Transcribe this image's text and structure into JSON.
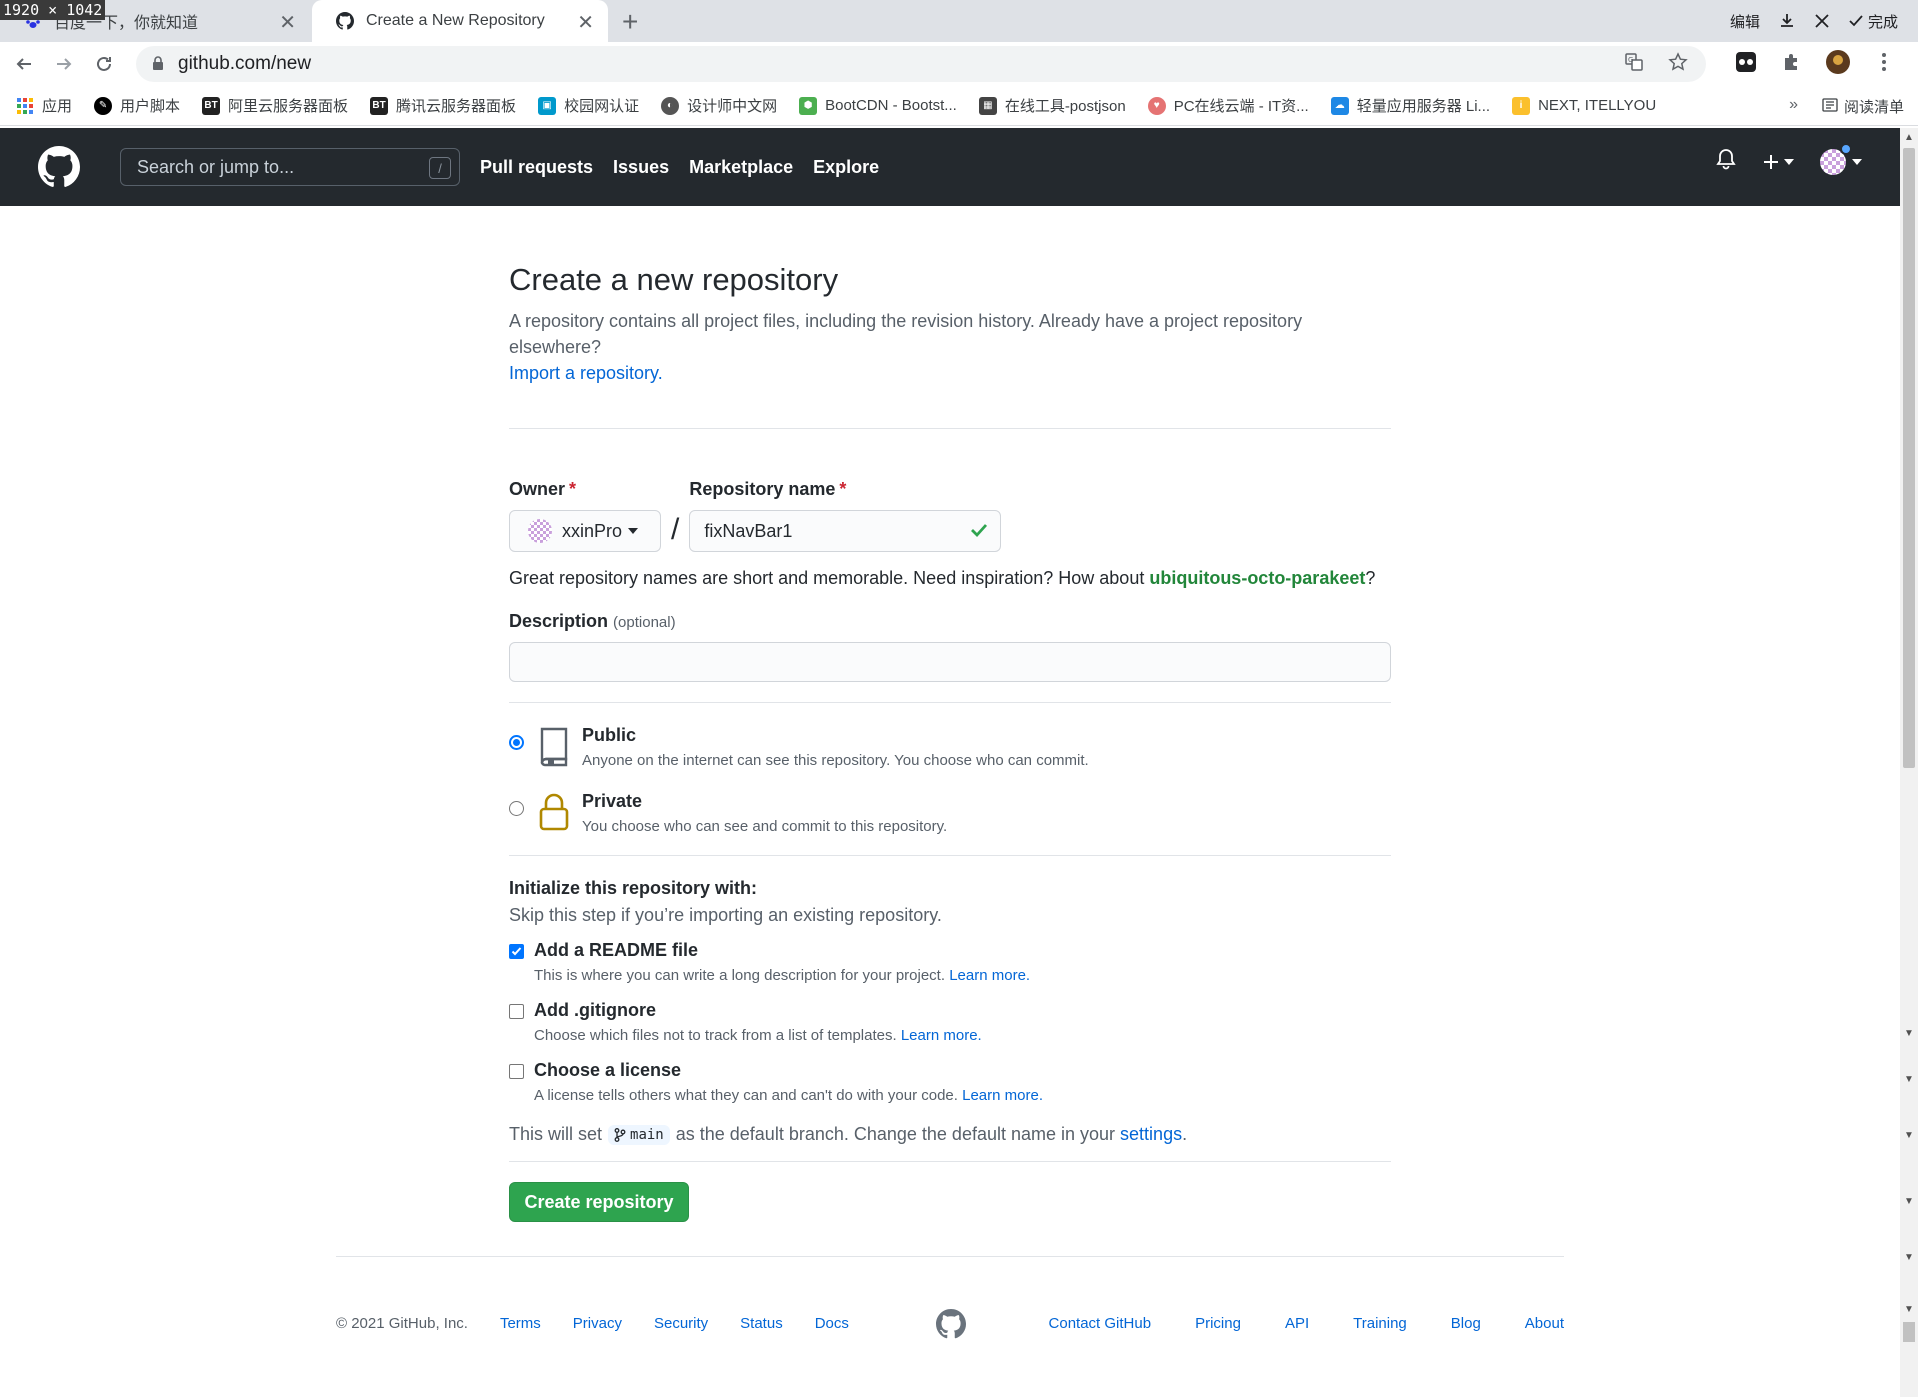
{
  "overlay": {
    "dimensions": "1920 × 1042"
  },
  "browser": {
    "tabs": [
      {
        "title": "百度一下，你就知道"
      },
      {
        "title": "Create a New Repository"
      }
    ],
    "window_controls": {
      "edit": "编辑",
      "done": "完成"
    },
    "url": "github.com/new",
    "bookmarks": [
      {
        "label": "应用",
        "icon": "apps-grid-icon",
        "color": "#4285f4"
      },
      {
        "label": "用户脚本",
        "icon": "userscript-icon",
        "color": "#000000"
      },
      {
        "label": "阿里云服务器面板",
        "icon": "bt-icon",
        "color": "#222222"
      },
      {
        "label": "腾讯云服务器面板",
        "icon": "bt-icon",
        "color": "#222222"
      },
      {
        "label": "校园网认证",
        "icon": "campus-icon",
        "color": "#0099cc"
      },
      {
        "label": "设计师中文网",
        "icon": "design-icon",
        "color": "#555555"
      },
      {
        "label": "BootCDN - Bootst...",
        "icon": "bootcdn-icon",
        "color": "#4caf50"
      },
      {
        "label": "在线工具-postjson",
        "icon": "qr-icon",
        "color": "#444444"
      },
      {
        "label": "PC在线云端 - IT资...",
        "icon": "pc-icon",
        "color": "#e57373"
      },
      {
        "label": "轻量应用服务器 Li...",
        "icon": "cloud-icon",
        "color": "#1e88e5"
      },
      {
        "label": "NEXT, ITELLYOU",
        "icon": "itellyou-icon",
        "color": "#fbc02d"
      }
    ],
    "bookmarks_more": "»",
    "reading_list": "阅读清单"
  },
  "header": {
    "search_placeholder": "Search or jump to...",
    "search_shortcut": "/",
    "nav": [
      "Pull requests",
      "Issues",
      "Marketplace",
      "Explore"
    ]
  },
  "form": {
    "title": "Create a new repository",
    "subtitle": "A repository contains all project files, including the revision history. Already have a project repository elsewhere?",
    "import_link": "Import a repository.",
    "owner_label": "Owner",
    "owner_value": "xxinPro",
    "repo_label": "Repository name",
    "repo_value": "fixNavBar1",
    "required_mark": "*",
    "name_hint_prefix": "Great repository names are short and memorable. Need inspiration? How about",
    "name_suggestion": "ubiquitous-octo-parakeet",
    "name_hint_suffix": "?",
    "description_label": "Description",
    "description_optional": "(optional)",
    "description_value": "",
    "visibility": [
      {
        "title": "Public",
        "desc": "Anyone on the internet can see this repository. You choose who can commit.",
        "selected": true
      },
      {
        "title": "Private",
        "desc": "You choose who can see and commit to this repository.",
        "selected": false
      }
    ],
    "init_title": "Initialize this repository with:",
    "init_sub": "Skip this step if you’re importing an existing repository.",
    "init_options": [
      {
        "title": "Add a README file",
        "desc": "This is where you can write a long description for your project.",
        "link": "Learn more.",
        "checked": true
      },
      {
        "title": "Add .gitignore",
        "desc": "Choose which files not to track from a list of templates.",
        "link": "Learn more.",
        "checked": false
      },
      {
        "title": "Choose a license",
        "desc": "A license tells others what they can and can't do with your code.",
        "link": "Learn more.",
        "checked": false
      }
    ],
    "branch_prefix": "This will set",
    "branch_name": "main",
    "branch_suffix": "as the default branch. Change the default name in your",
    "branch_settings_link": "settings",
    "branch_end": ".",
    "submit_label": "Create repository"
  },
  "footer": {
    "copyright": "© 2021 GitHub, Inc.",
    "left_links": [
      "Terms",
      "Privacy",
      "Security",
      "Status",
      "Docs"
    ],
    "right_links": [
      "Contact GitHub",
      "Pricing",
      "API",
      "Training",
      "Blog",
      "About"
    ]
  },
  "colors": {
    "header_bg": "#24292e",
    "link": "#0366d6",
    "green_button": "#2ea44f",
    "suggestion_green": "#22863a"
  }
}
